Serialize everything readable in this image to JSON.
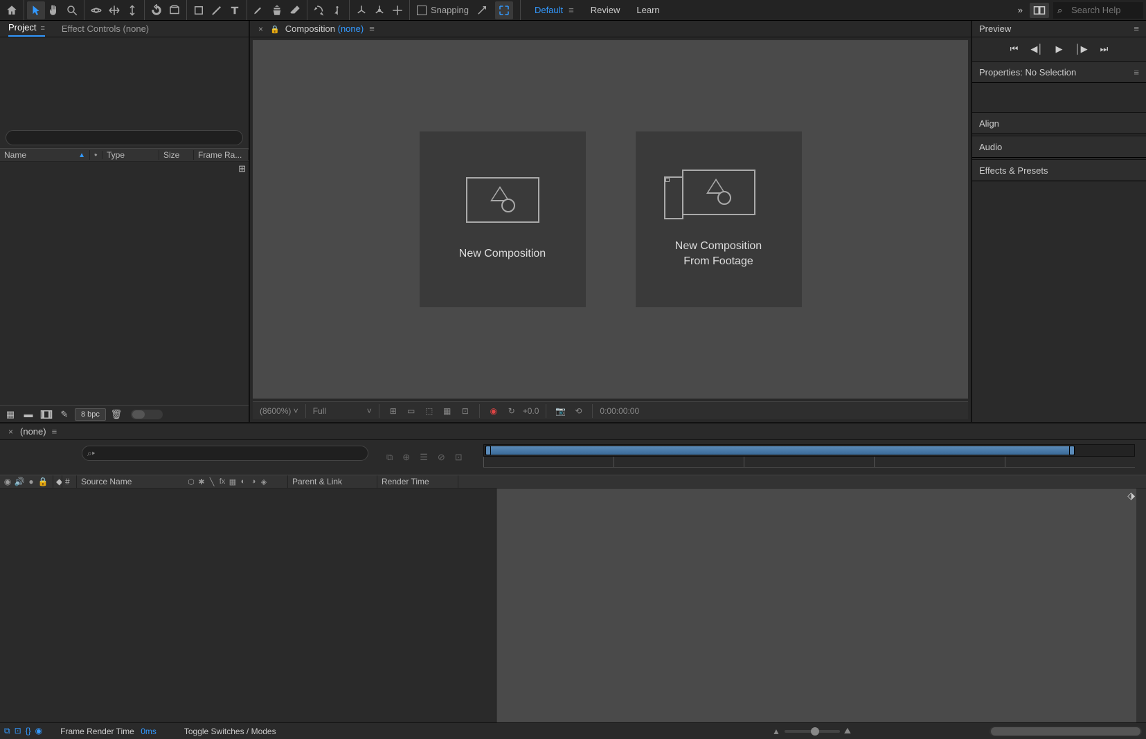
{
  "toolbar": {
    "snapping_label": "Snapping"
  },
  "workspaces": {
    "default": "Default",
    "review": "Review",
    "learn": "Learn"
  },
  "search": {
    "placeholder": "Search Help"
  },
  "project_panel": {
    "project_tab": "Project",
    "effect_controls_tab": "Effect Controls",
    "effect_controls_suffix": "(none)",
    "col_name": "Name",
    "col_type": "Type",
    "col_size": "Size",
    "col_frame_rate": "Frame Ra...",
    "bpc": "8 bpc"
  },
  "composition_panel": {
    "tab_label": "Composition",
    "tab_none": "(none)",
    "card_new_comp": "New Composition",
    "card_from_footage_l1": "New Composition",
    "card_from_footage_l2": "From Footage",
    "zoom_value": "(8600%)",
    "resolution": "Full",
    "exposure": "+0.0",
    "timecode": "0:00:00:00"
  },
  "preview_panel": {
    "title": "Preview"
  },
  "right_panels": {
    "properties": "Properties: No Selection",
    "align": "Align",
    "audio": "Audio",
    "effects_presets": "Effects & Presets"
  },
  "timeline": {
    "tab_none": "(none)",
    "col_hash": "#",
    "col_source": "Source Name",
    "col_parent": "Parent & Link",
    "col_render": "Render Time",
    "frame_render_time_label": "Frame Render Time",
    "frame_render_time_value": "0ms",
    "toggle_switches": "Toggle Switches / Modes"
  }
}
